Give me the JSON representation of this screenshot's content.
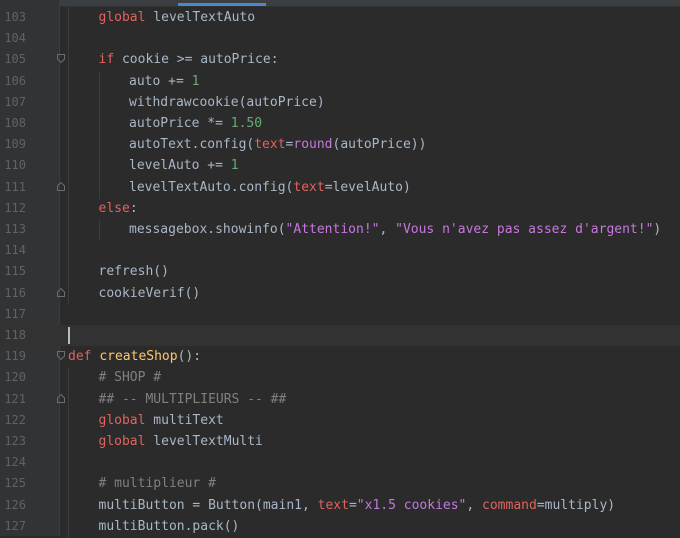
{
  "editor": {
    "colors": {
      "background": "#2b2b2b",
      "gutter": "#313335",
      "current_line": "#323232",
      "keyword": "#e0635c",
      "function_def": "#ffc66d",
      "number": "#6aab73",
      "string": "#c678dd",
      "comment": "#808080",
      "kwarg": "#e0635c",
      "tab_accent": "#4a88c7"
    },
    "current_line_number": "118",
    "lines": [
      {
        "n": "103",
        "tokens": [
          {
            "t": "global ",
            "c": "red"
          },
          {
            "t": "levelTextAuto",
            "c": "id"
          }
        ]
      },
      {
        "n": "104",
        "tokens": []
      },
      {
        "n": "105",
        "tokens": [
          {
            "t": "if ",
            "c": "red"
          },
          {
            "t": "cookie >= autoPrice:",
            "c": "id"
          }
        ]
      },
      {
        "n": "106",
        "tokens": [
          {
            "t": "auto += ",
            "c": "id"
          },
          {
            "t": "1",
            "c": "grn"
          }
        ]
      },
      {
        "n": "107",
        "tokens": [
          {
            "t": "withdrawcookie(autoPrice)",
            "c": "id"
          }
        ]
      },
      {
        "n": "108",
        "tokens": [
          {
            "t": "autoPrice *= ",
            "c": "id"
          },
          {
            "t": "1.50",
            "c": "grn"
          }
        ]
      },
      {
        "n": "109",
        "tokens": [
          {
            "t": "autoText.config(",
            "c": "id"
          },
          {
            "t": "text",
            "c": "red"
          },
          {
            "t": "=",
            "c": "id"
          },
          {
            "t": "round",
            "c": "strp"
          },
          {
            "t": "(autoPrice))",
            "c": "id"
          }
        ]
      },
      {
        "n": "110",
        "tokens": [
          {
            "t": "levelAuto += ",
            "c": "id"
          },
          {
            "t": "1",
            "c": "grn"
          }
        ]
      },
      {
        "n": "111",
        "tokens": [
          {
            "t": "levelTextAuto.config(",
            "c": "id"
          },
          {
            "t": "text",
            "c": "red"
          },
          {
            "t": "=levelAuto)",
            "c": "id"
          }
        ]
      },
      {
        "n": "112",
        "tokens": [
          {
            "t": "else",
            "c": "red"
          },
          {
            "t": ":",
            "c": "id"
          }
        ]
      },
      {
        "n": "113",
        "tokens": [
          {
            "t": "messagebox.showinfo(",
            "c": "id"
          },
          {
            "t": "\"Attention!\"",
            "c": "strp"
          },
          {
            "t": ", ",
            "c": "id"
          },
          {
            "t": "\"Vous n'avez pas assez d'argent!\"",
            "c": "strp"
          },
          {
            "t": ")",
            "c": "id"
          }
        ]
      },
      {
        "n": "114",
        "tokens": []
      },
      {
        "n": "115",
        "tokens": [
          {
            "t": "refresh()",
            "c": "id"
          }
        ]
      },
      {
        "n": "116",
        "tokens": [
          {
            "t": "cookieVerif()",
            "c": "id"
          }
        ]
      },
      {
        "n": "117",
        "tokens": []
      },
      {
        "n": "118",
        "tokens": []
      },
      {
        "n": "119",
        "tokens": [
          {
            "t": "def ",
            "c": "red"
          },
          {
            "t": "createShop",
            "c": "fn"
          },
          {
            "t": "():",
            "c": "id"
          }
        ]
      },
      {
        "n": "120",
        "tokens": [
          {
            "t": "# SHOP #",
            "c": "cmt"
          }
        ]
      },
      {
        "n": "121",
        "tokens": [
          {
            "t": "## -- MULTIPLIEURS -- ##",
            "c": "cmt"
          }
        ]
      },
      {
        "n": "122",
        "tokens": [
          {
            "t": "global ",
            "c": "red"
          },
          {
            "t": "multiText",
            "c": "id"
          }
        ]
      },
      {
        "n": "123",
        "tokens": [
          {
            "t": "global ",
            "c": "red"
          },
          {
            "t": "levelTextMulti",
            "c": "id"
          }
        ]
      },
      {
        "n": "124",
        "tokens": []
      },
      {
        "n": "125",
        "tokens": [
          {
            "t": "# multiplieur #",
            "c": "cmt"
          }
        ]
      },
      {
        "n": "126",
        "tokens": [
          {
            "t": "multiButton = Button(main1, ",
            "c": "id"
          },
          {
            "t": "text",
            "c": "red"
          },
          {
            "t": "=",
            "c": "id"
          },
          {
            "t": "\"x1.5 cookies\"",
            "c": "strp"
          },
          {
            "t": ", ",
            "c": "id"
          },
          {
            "t": "command",
            "c": "red"
          },
          {
            "t": "=multiply)",
            "c": "id"
          }
        ]
      },
      {
        "n": "127",
        "tokens": [
          {
            "t": "multiButton.pack()",
            "c": "id"
          }
        ]
      }
    ]
  }
}
